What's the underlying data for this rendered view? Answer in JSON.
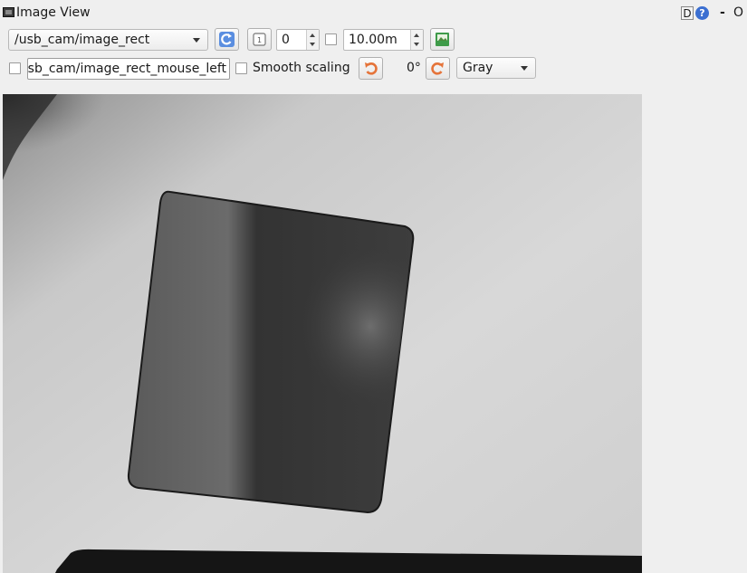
{
  "window": {
    "title": "Image View",
    "d_button": "D",
    "help_button": "?",
    "minimize": "-",
    "close": "O"
  },
  "toolbar": {
    "topic_selected": "/usb_cam/image_rect",
    "refresh_icon": "refresh-icon",
    "zoom_icon": "zoom-icon",
    "spin_value": "0",
    "spin_checkbox_checked": false,
    "duration_value": "10.00m",
    "save_icon": "save-image-icon"
  },
  "row2": {
    "mouse_checkbox_checked": false,
    "mouse_topic_value": "/usb_cam/image_rect_mouse_left",
    "smooth_checkbox_checked": false,
    "smooth_label": "Smooth scaling",
    "rotate_left_icon": "rotate-ccw-icon",
    "rotation_value": "0°",
    "rotate_right_icon": "rotate-cw-icon",
    "color_scheme_selected": "Gray"
  },
  "image": {
    "description_icon": "camera-image"
  },
  "colors": {
    "background": "#efefef",
    "accent_blue": "#3b6fd1",
    "accent_orange": "#e5743a"
  }
}
